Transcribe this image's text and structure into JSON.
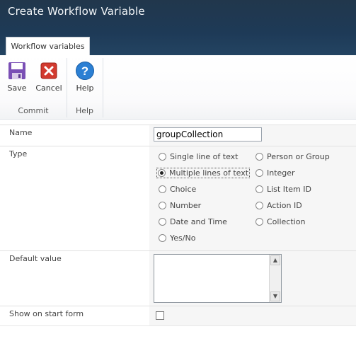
{
  "window": {
    "title": "Create Workflow Variable"
  },
  "ribbon": {
    "tab_label": "Workflow variables",
    "buttons": {
      "save": "Save",
      "cancel": "Cancel",
      "help": "Help"
    },
    "groups": {
      "commit": "Commit",
      "help": "Help"
    }
  },
  "form": {
    "name": {
      "label": "Name",
      "value": "groupCollection"
    },
    "type": {
      "label": "Type",
      "selected": "Multiple lines of text",
      "options_left": [
        "Single line of text",
        "Multiple lines of text",
        "Choice",
        "Number",
        "Date and Time",
        "Yes/No"
      ],
      "options_right": [
        "Person or Group",
        "Integer",
        "List Item ID",
        "Action ID",
        "Collection"
      ]
    },
    "default_value": {
      "label": "Default value",
      "value": ""
    },
    "show_on_start": {
      "label": "Show on start form",
      "checked": false
    }
  },
  "colors": {
    "title_bar": "#21374c",
    "field_bg": "#f6f6f6"
  }
}
